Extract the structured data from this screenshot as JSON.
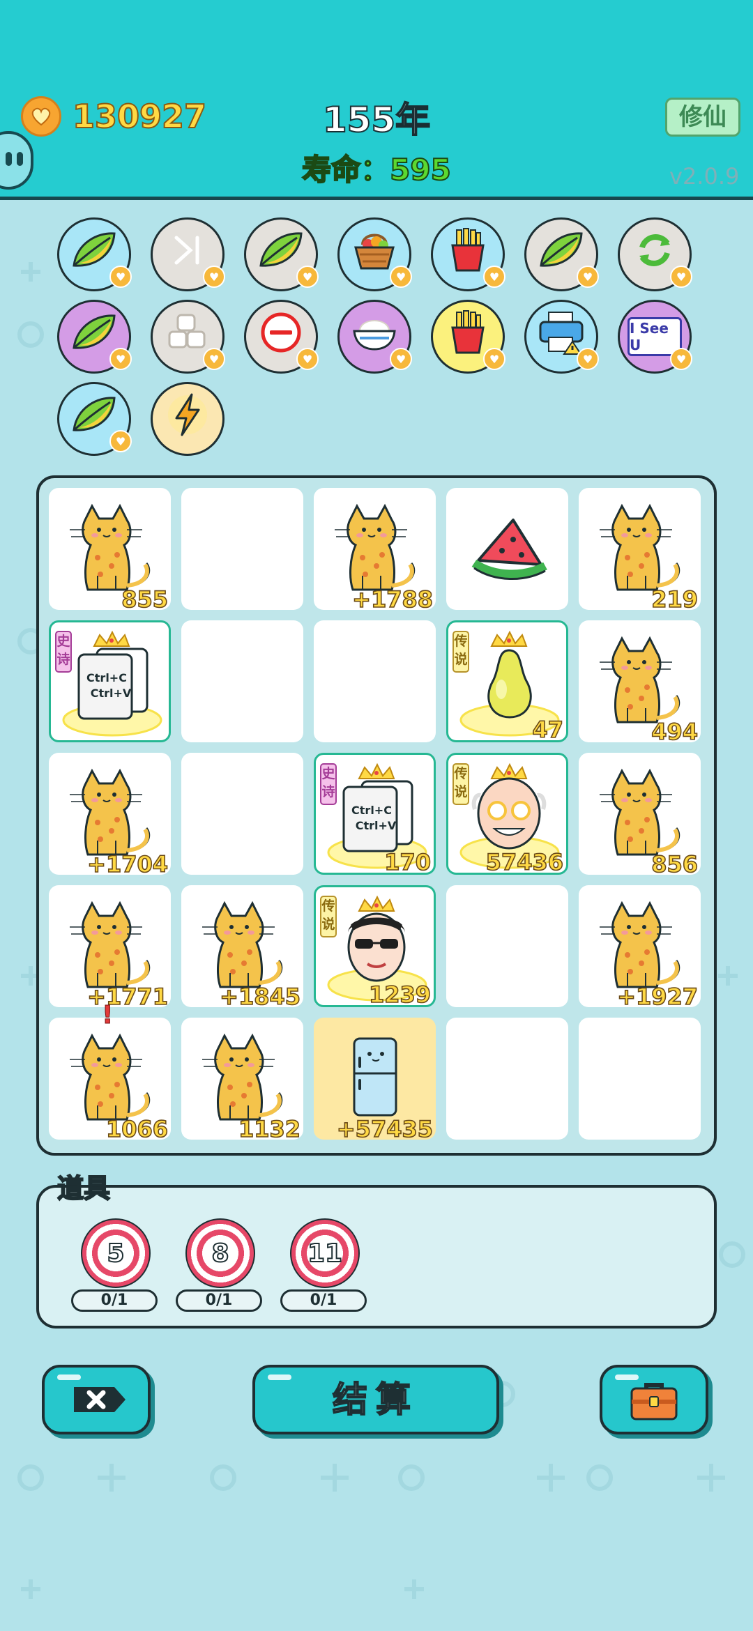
{
  "header": {
    "coins": "130927",
    "year": "155年",
    "life": "寿命：595",
    "xiuxian_button": "修仙",
    "version": "v2.0.9"
  },
  "skills": [
    {
      "icon": "leaf-icon",
      "color": "blue"
    },
    {
      "icon": "skip-icon",
      "color": "gray"
    },
    {
      "icon": "leaf-icon",
      "color": "gray"
    },
    {
      "icon": "fruit-basket-icon",
      "color": "blue"
    },
    {
      "icon": "fries-icon",
      "color": "blue"
    },
    {
      "icon": "leaf-icon",
      "color": "gray"
    },
    {
      "icon": "refresh-icon",
      "color": "gray"
    },
    {
      "icon": "leaf-icon",
      "color": "purple"
    },
    {
      "icon": "tofu-icon",
      "color": "gray"
    },
    {
      "icon": "minus-circle-icon",
      "color": "gray"
    },
    {
      "icon": "rice-bowl-icon",
      "color": "purple"
    },
    {
      "icon": "fries-icon",
      "color": "yellow"
    },
    {
      "icon": "printer-icon",
      "color": "blue"
    },
    {
      "icon": "i-see-u-icon",
      "color": "purple",
      "label": "I See U"
    },
    {
      "icon": "leaf-icon",
      "color": "blue"
    },
    {
      "icon": "lightning-icon",
      "color": "cream"
    }
  ],
  "board": {
    "cells": [
      {
        "type": "cat",
        "num": "855"
      },
      {
        "type": "empty"
      },
      {
        "type": "cat",
        "num": "+1788"
      },
      {
        "type": "watermelon"
      },
      {
        "type": "cat",
        "num": "219"
      },
      {
        "type": "copy",
        "tag": "史诗",
        "rarity": "epic"
      },
      {
        "type": "empty"
      },
      {
        "type": "empty"
      },
      {
        "type": "pear",
        "tag": "传说",
        "rarity": "legend",
        "num": "47"
      },
      {
        "type": "cat",
        "num": "494"
      },
      {
        "type": "cat",
        "num": "+1704"
      },
      {
        "type": "empty"
      },
      {
        "type": "copy",
        "tag": "史诗",
        "rarity": "epic",
        "num": "170"
      },
      {
        "type": "oldman",
        "tag": "传说",
        "rarity": "legend",
        "num": "57436"
      },
      {
        "type": "cat",
        "num": "856"
      },
      {
        "type": "cat",
        "num": "+1771"
      },
      {
        "type": "cat",
        "num": "+1845"
      },
      {
        "type": "sunglasses",
        "tag": "传说",
        "rarity": "legend",
        "num": "1239"
      },
      {
        "type": "empty"
      },
      {
        "type": "cat",
        "num": "+1927"
      },
      {
        "type": "cat",
        "num": "1066",
        "alert": "!"
      },
      {
        "type": "cat",
        "num": "1132"
      },
      {
        "type": "fridge",
        "num": "+57435"
      },
      {
        "type": "empty"
      },
      {
        "type": "empty"
      }
    ],
    "copy_text_1": "Ctrl+C",
    "copy_text_2": "Ctrl+V"
  },
  "items": {
    "title": "道具",
    "list": [
      {
        "value": "5",
        "count": "0/1"
      },
      {
        "value": "8",
        "count": "0/1"
      },
      {
        "value": "11",
        "count": "0/1"
      }
    ]
  },
  "buttons": {
    "settle": "结算"
  },
  "colors": {
    "header": "#25ccd0",
    "background": "#b3e3ea",
    "number": "#ffd944",
    "epic": "#a43c97",
    "legend": "#b6932a"
  }
}
